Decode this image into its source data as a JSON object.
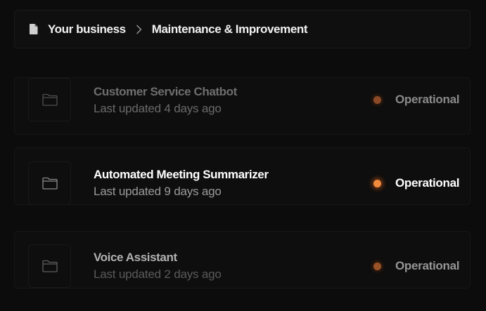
{
  "breadcrumb": {
    "icon": "document-icon",
    "items": [
      {
        "label": "Your business"
      },
      {
        "label": "Maintenance & Improvement"
      }
    ],
    "separator_icon": "chevron-right-icon"
  },
  "projects": [
    {
      "icon": "folder-icon",
      "title": "Customer Service Chatbot",
      "updated": "Last updated 4 days ago",
      "status": "Operational",
      "status_color": "#f08a3c"
    },
    {
      "icon": "folder-icon",
      "title": "Automated Meeting Summarizer",
      "updated": "Last updated 9 days ago",
      "status": "Operational",
      "status_color": "#f08a3c"
    },
    {
      "icon": "folder-icon",
      "title": "Voice Assistant",
      "updated": "Last updated 2 days ago",
      "status": "Operational",
      "status_color": "#f08a3c"
    }
  ]
}
